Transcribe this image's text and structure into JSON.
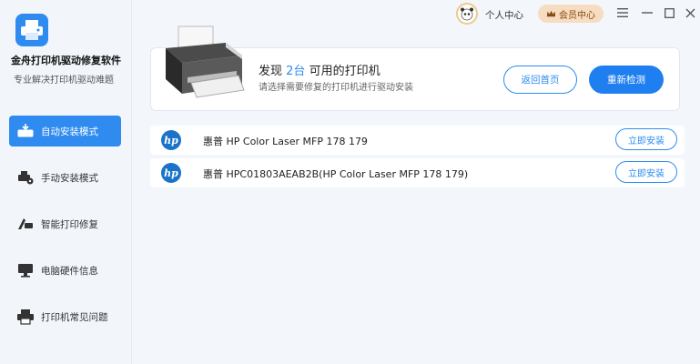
{
  "app": {
    "title": "金舟打印机驱动修复软件",
    "subtitle": "专业解决打印机驱动难题"
  },
  "sidebar": {
    "items": [
      {
        "label": "自动安装模式",
        "icon": "printer-download-icon",
        "active": true
      },
      {
        "label": "手动安装模式",
        "icon": "printer-gear-icon",
        "active": false
      },
      {
        "label": "智能打印修复",
        "icon": "printer-repair-icon",
        "active": false
      },
      {
        "label": "电脑硬件信息",
        "icon": "monitor-icon",
        "active": false
      },
      {
        "label": "打印机常见问题",
        "icon": "printer-help-icon",
        "active": false
      }
    ]
  },
  "topbar": {
    "user_center": "个人中心",
    "member_center": "会员中心"
  },
  "banner": {
    "found_prefix": "发现",
    "found_count": "2台",
    "found_suffix": "可用的打印机",
    "hint": "请选择需要修复的打印机进行驱动安装",
    "home_button": "返回首页",
    "redetect_button": "重新检测"
  },
  "printers": [
    {
      "logo": "hp",
      "name": "惠普 HP Color Laser MFP 178 179",
      "action": "立即安装"
    },
    {
      "logo": "hp",
      "name": "惠普 HPC01803AEAB2B(HP Color Laser MFP 178 179)",
      "action": "立即安装"
    }
  ],
  "colors": {
    "accent": "#2f8bf0",
    "member_bg": "#f6dcc0"
  }
}
